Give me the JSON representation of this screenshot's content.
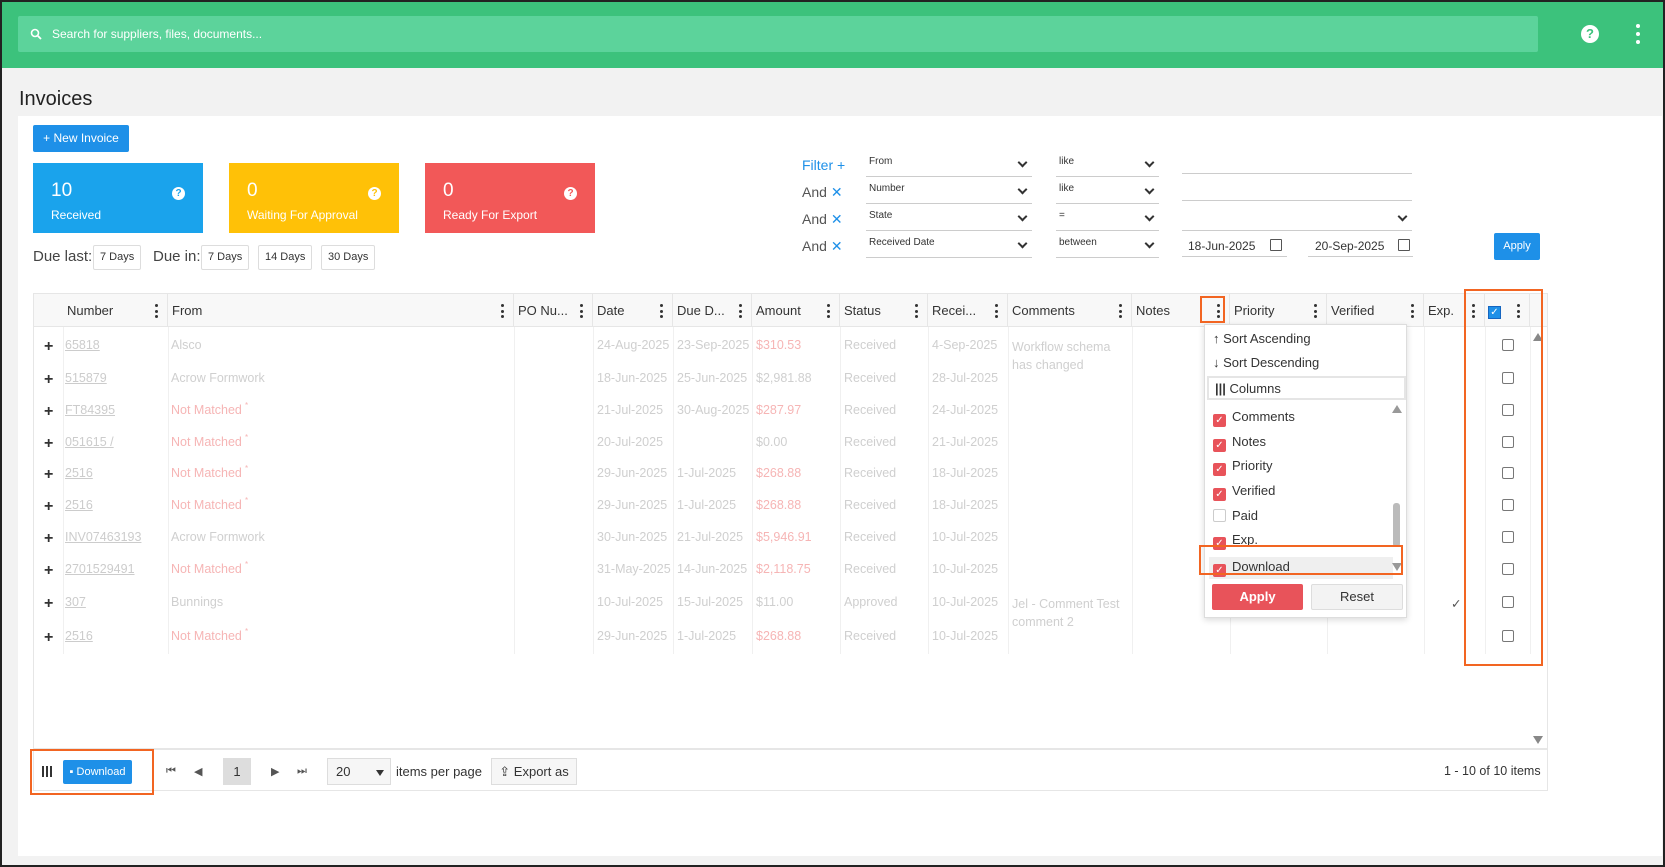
{
  "header": {
    "search_placeholder": "Search for suppliers, files, documents...",
    "help": "?"
  },
  "page": {
    "title": "Invoices",
    "new_invoice": "+ New Invoice"
  },
  "cards": [
    {
      "count": "10",
      "label": "Received",
      "color": "#1aa3ec"
    },
    {
      "count": "0",
      "label": "Waiting For Approval",
      "color": "#ffc107"
    },
    {
      "count": "0",
      "label": "Ready For Export",
      "color": "#f25858"
    }
  ],
  "due": {
    "last_label": "Due last:",
    "last_chip": "7 Days",
    "in_label": "Due in:",
    "in_chips": [
      "7 Days",
      "14 Days",
      "30 Days"
    ]
  },
  "filters": {
    "filter_label": "Filter +",
    "and_label": "And",
    "rows": [
      {
        "field": "From",
        "op": "like",
        "value": ""
      },
      {
        "field": "Number",
        "op": "like",
        "value": ""
      },
      {
        "field": "State",
        "op": "=",
        "value": ""
      },
      {
        "field": "Received Date",
        "op": "between",
        "value": "18-Jun-2025",
        "value2": "20-Sep-2025"
      }
    ],
    "apply": "Apply"
  },
  "columns": [
    "Number",
    "From",
    "PO Nu...",
    "Date",
    "Due D...",
    "Amount",
    "Status",
    "Recei...",
    "Comments",
    "Notes",
    "Priority",
    "Verified",
    "Exp."
  ],
  "rows": [
    {
      "number": "65818",
      "from": "Alsco",
      "from_red": false,
      "date": "24-Aug-2025",
      "due": "23-Sep-2025",
      "amount": "$310.53",
      "amount_red": true,
      "status": "Received",
      "received": "4-Sep-2025",
      "comments": "Workflow schema has changed",
      "verified": ""
    },
    {
      "number": "515879",
      "from": "Acrow Formwork",
      "from_red": false,
      "date": "18-Jun-2025",
      "due": "25-Jun-2025",
      "amount": "$2,981.88",
      "amount_red": false,
      "status": "Received",
      "received": "28-Jul-2025",
      "comments": "",
      "verified": ""
    },
    {
      "number": "FT84395",
      "from": "Not Matched",
      "from_red": true,
      "date": "21-Jul-2025",
      "due": "30-Aug-2025",
      "amount": "$287.97",
      "amount_red": true,
      "status": "Received",
      "received": "24-Jul-2025",
      "comments": "",
      "verified": ""
    },
    {
      "number": "051615 /",
      "from": "Not Matched",
      "from_red": true,
      "date": "20-Jul-2025",
      "due": "",
      "amount": "$0.00",
      "amount_red": false,
      "status": "Received",
      "received": "21-Jul-2025",
      "comments": "",
      "verified": ""
    },
    {
      "number": "2516",
      "from": "Not Matched",
      "from_red": true,
      "date": "29-Jun-2025",
      "due": "1-Jul-2025",
      "amount": "$268.88",
      "amount_red": true,
      "status": "Received",
      "received": "18-Jul-2025",
      "comments": "",
      "verified": ""
    },
    {
      "number": "2516",
      "from": "Not Matched",
      "from_red": true,
      "date": "29-Jun-2025",
      "due": "1-Jul-2025",
      "amount": "$268.88",
      "amount_red": true,
      "status": "Received",
      "received": "18-Jul-2025",
      "comments": "",
      "verified": ""
    },
    {
      "number": "INV07463193",
      "from": "Acrow Formwork",
      "from_red": false,
      "date": "30-Jun-2025",
      "due": "21-Jul-2025",
      "amount": "$5,946.91",
      "amount_red": true,
      "status": "Received",
      "received": "10-Jul-2025",
      "comments": "",
      "verified": ""
    },
    {
      "number": "2701529491",
      "from": "Not Matched",
      "from_red": true,
      "date": "31-May-2025",
      "due": "14-Jun-2025",
      "amount": "$2,118.75",
      "amount_red": true,
      "status": "Received",
      "received": "10-Jul-2025",
      "comments": "",
      "verified": ""
    },
    {
      "number": "307",
      "from": "Bunnings",
      "from_red": false,
      "date": "10-Jul-2025",
      "due": "15-Jul-2025",
      "amount": "$11.00",
      "amount_red": false,
      "status": "Approved",
      "received": "10-Jul-2025",
      "comments": "Jel - Comment Test comment 2",
      "verified": "✓"
    },
    {
      "number": "2516",
      "from": "Not Matched",
      "from_red": true,
      "date": "29-Jun-2025",
      "due": "1-Jul-2025",
      "amount": "$268.88",
      "amount_red": true,
      "status": "Received",
      "received": "10-Jul-2025",
      "comments": "",
      "verified": ""
    }
  ],
  "column_menu": {
    "sort_asc": "Sort Ascending",
    "sort_desc": "Sort Descending",
    "columns_label": "Columns",
    "items": [
      {
        "label": "Comments",
        "checked": true
      },
      {
        "label": "Notes",
        "checked": true
      },
      {
        "label": "Priority",
        "checked": true
      },
      {
        "label": "Verified",
        "checked": true
      },
      {
        "label": "Paid",
        "checked": false
      },
      {
        "label": "Exp.",
        "checked": true
      },
      {
        "label": "Download",
        "checked": true
      }
    ],
    "apply": "Apply",
    "reset": "Reset"
  },
  "footer": {
    "download": "Download",
    "page": "1",
    "per_page": "20",
    "items_per_page": "items per page",
    "export": "Export as",
    "summary": "1 - 10 of 10 items"
  },
  "colors": {
    "topbar": "#3cc27c",
    "accent": "#1e90e8",
    "highlight": "#f26522",
    "menu_check": "#e8535a"
  }
}
